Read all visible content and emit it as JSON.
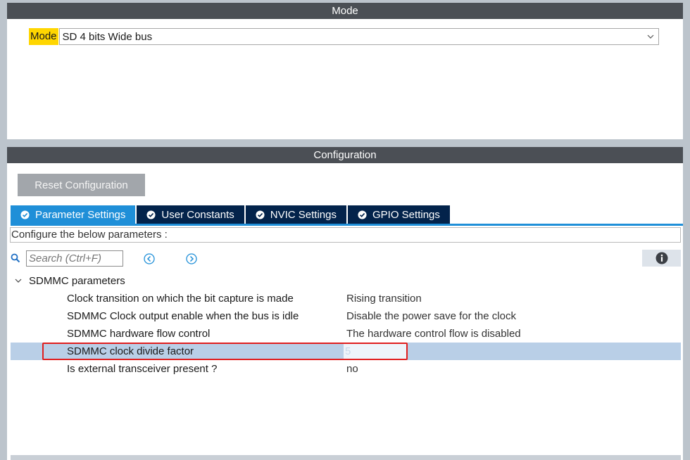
{
  "mode_panel": {
    "title": "Mode",
    "mode_label": "Mode",
    "mode_value": "SD 4 bits Wide bus"
  },
  "config_panel": {
    "title": "Configuration",
    "reset_button": "Reset Configuration",
    "tabs": [
      {
        "label": "Parameter Settings",
        "active": true
      },
      {
        "label": "User Constants",
        "active": false
      },
      {
        "label": "NVIC Settings",
        "active": false
      },
      {
        "label": "GPIO Settings",
        "active": false
      }
    ],
    "hint": "Configure the below parameters :",
    "search_placeholder": "Search (Ctrl+F)",
    "group_title": "SDMMC parameters",
    "params": [
      {
        "name": "Clock transition on which the bit capture is made",
        "value": "Rising transition"
      },
      {
        "name": "SDMMC Clock output enable when the bus is idle",
        "value": "Disable the power save for the clock"
      },
      {
        "name": "SDMMC hardware flow control",
        "value": "The hardware control flow is disabled"
      },
      {
        "name": "SDMMC clock divide factor",
        "value": "5",
        "selected": true
      },
      {
        "name": "Is external transceiver present ?",
        "value": "no"
      }
    ]
  },
  "colors": {
    "header": "#4b4f55",
    "tab_active": "#1f8fd8",
    "tab_inactive": "#03234b",
    "mode_highlight": "#ffd600",
    "selection": "#b9cfe7",
    "annotation_box": "#e01e1e"
  }
}
